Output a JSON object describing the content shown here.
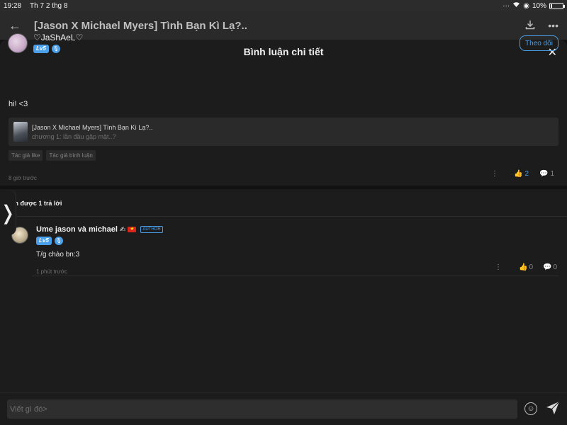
{
  "status_bar": {
    "time": "19:28",
    "date": "Th 7 2 thg 8",
    "battery": "10%",
    "battery_level": 0.1
  },
  "app_header": {
    "title": "[Jason X Michael Myers] Tình Bạn Kì Lạ?.."
  },
  "sheet": {
    "title": "Bình luận chi tiết"
  },
  "comment": {
    "author": "♡JaShAeL♡",
    "level": "Lv5",
    "follow_label": "Theo dõi",
    "text": "hi! <3",
    "story_title": "[Jason X Michael Myers] Tình Bạn Kì Lạ?..",
    "story_chapter": "chương 1: lần đầu gặp mặt..?",
    "tags": [
      "Tác giả like",
      "Tác giả bình luận"
    ],
    "time": "8 giờ trước",
    "likes": "2",
    "replies": "1"
  },
  "replies_header": "hận được 1 trả lời",
  "reply": {
    "author": "Ume jason và michael",
    "author_tag": "AUTHOR",
    "level": "Lv5",
    "text": "T/g chào bn:3",
    "time": "1 phút trước",
    "likes": "0",
    "replies": "0"
  },
  "composer": {
    "placeholder": "Viết gì đó>"
  },
  "colors": {
    "accent": "#4a9fe8",
    "background": "#1c1c1c"
  }
}
